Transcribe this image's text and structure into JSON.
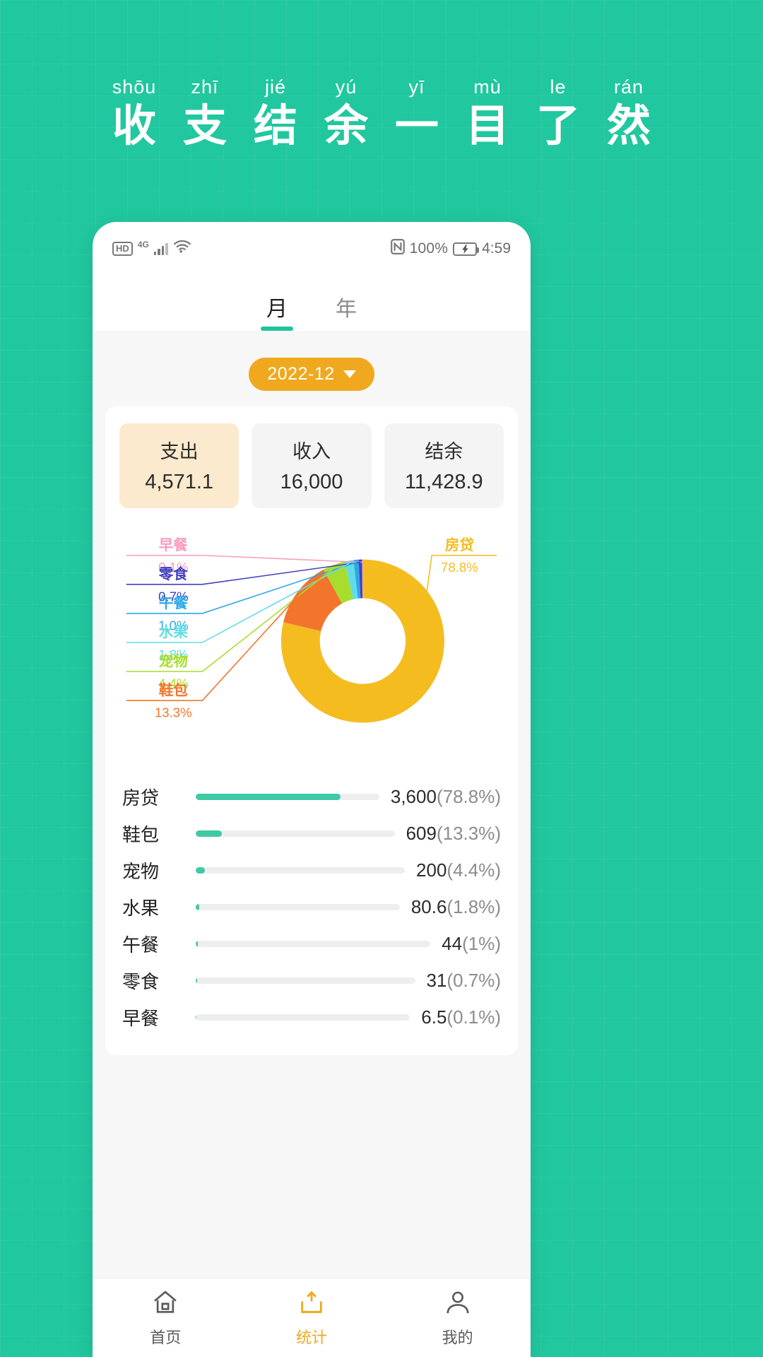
{
  "promo": {
    "pinyin": [
      "shōu",
      "zhī",
      "jié",
      "yú",
      "yī",
      "mù",
      "le",
      "rán"
    ],
    "hanzi": [
      "收",
      "支",
      "结",
      "余",
      "一",
      "目",
      "了",
      "然"
    ],
    "text_color": "#ffffff",
    "background_color": "#21c79e"
  },
  "statusbar": {
    "hd_label": "HD",
    "network_label": "4G",
    "wifi_icon": "wifi-icon",
    "nfc_icon": "nfc-icon",
    "battery_percent": "100%",
    "battery_icon": "battery-charging-icon",
    "time": "4:59"
  },
  "tabs": [
    {
      "label": "月",
      "active": true
    },
    {
      "label": "年",
      "active": false
    }
  ],
  "date_selector": {
    "value": "2022-12",
    "caret_icon": "chevron-down-icon",
    "color": "#f0a81e"
  },
  "summary": [
    {
      "label": "支出",
      "value": "4,571.1",
      "selected": true
    },
    {
      "label": "收入",
      "value": "16,000",
      "selected": false
    },
    {
      "label": "结余",
      "value": "11,428.9",
      "selected": false
    }
  ],
  "chart_data": {
    "type": "pie",
    "title": "",
    "donut": true,
    "categories": [
      "房贷",
      "鞋包",
      "宠物",
      "水果",
      "午餐",
      "零食",
      "早餐"
    ],
    "values": [
      3600,
      609,
      200,
      80.6,
      44,
      31,
      6.5
    ],
    "percents": [
      78.8,
      13.3,
      4.4,
      1.8,
      1.0,
      0.7,
      0.1
    ],
    "percent_labels": [
      "78.8%",
      "13.3%",
      "4.4%",
      "1.8%",
      "1.0%",
      "0.7%",
      "0.1%"
    ],
    "colors": [
      "#f5bc20",
      "#f2752b",
      "#a8dd2e",
      "#62dce6",
      "#2ba8e8",
      "#4040c0",
      "#f79dc0"
    ],
    "legend_position": "outside-callout",
    "total": 4571.1
  },
  "breakdown": {
    "rows": [
      {
        "name": "房贷",
        "amount": "3,600",
        "percent": "(78.8%)",
        "bar": 78.8
      },
      {
        "name": "鞋包",
        "amount": "609",
        "percent": "(13.3%)",
        "bar": 13.3
      },
      {
        "name": "宠物",
        "amount": "200",
        "percent": "(4.4%)",
        "bar": 4.4
      },
      {
        "name": "水果",
        "amount": "80.6",
        "percent": "(1.8%)",
        "bar": 1.8
      },
      {
        "name": "午餐",
        "amount": "44",
        "percent": "(1%)",
        "bar": 1.0
      },
      {
        "name": "零食",
        "amount": "31",
        "percent": "(0.7%)",
        "bar": 0.7
      },
      {
        "name": "早餐",
        "amount": "6.5",
        "percent": "(0.1%)",
        "bar": 0.1
      }
    ],
    "bar_color": "#3fc9a5"
  },
  "bottom_nav": [
    {
      "label": "首页",
      "icon": "home-icon",
      "active": false
    },
    {
      "label": "统计",
      "icon": "statistics-icon",
      "active": true
    },
    {
      "label": "我的",
      "icon": "user-icon",
      "active": false
    }
  ]
}
